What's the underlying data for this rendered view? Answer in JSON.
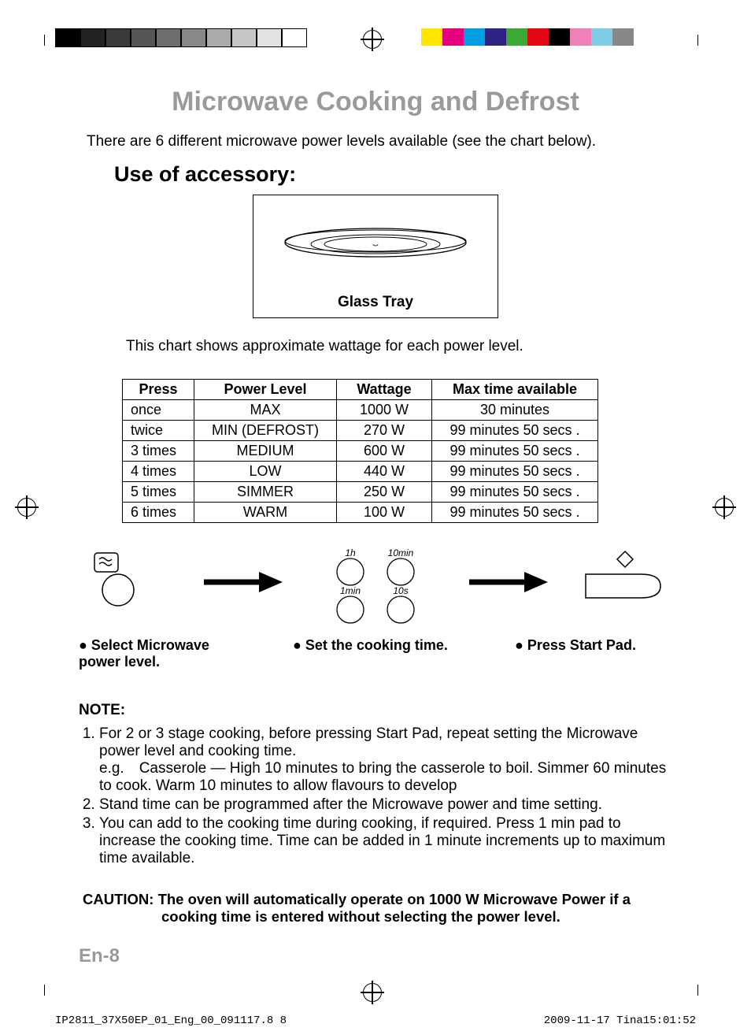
{
  "title": "Microwave Cooking and Defrost",
  "intro": "There are 6 different microwave power levels available (see the chart below).",
  "subheading": "Use of accessory:",
  "tray_label": "Glass Tray",
  "chart_intro": "This chart shows approximate wattage for each power level.",
  "table": {
    "headers": [
      "Press",
      "Power Level",
      "Wattage",
      "Max time available"
    ],
    "rows": [
      [
        "once",
        "MAX",
        "1000 W",
        "30 minutes"
      ],
      [
        "twice",
        "MIN (DEFROST)",
        "270 W",
        "99 minutes 50 secs ."
      ],
      [
        "3 times",
        "MEDIUM",
        "600 W",
        "99 minutes 50 secs ."
      ],
      [
        "4 times",
        "LOW",
        "440 W",
        "99 minutes 50 secs ."
      ],
      [
        "5 times",
        "SIMMER",
        "250 W",
        "99 minutes 50 secs ."
      ],
      [
        "6 times",
        "WARM",
        "100 W",
        "99 minutes 50 secs ."
      ]
    ]
  },
  "dial_labels": {
    "tl": "1h",
    "tr": "10min",
    "bl": "1min",
    "br": "10s"
  },
  "steps": {
    "s1": "● Select Microwave power level.",
    "s2": "● Set the cooking time.",
    "s3": "● Press Start Pad."
  },
  "note_heading": "NOTE:",
  "notes": [
    "For 2 or 3 stage cooking, before pressing Start Pad, repeat setting the Microwave power level and cooking time.\ne.g. Casserole — High 10 minutes to bring the casserole to boil. Simmer 60 minutes to cook. Warm 10 minutes to allow flavours to develop",
    "Stand time can be programmed after the Microwave power and time setting.",
    " You can add to the cooking time during cooking, if required. Press 1 min pad to increase the cooking time. Time can be added in 1 minute increments up to maximum time available."
  ],
  "caution_line1": "CAUTION: The oven will automatically operate on 1000 W Microwave Power if a",
  "caution_line2": "cooking time is entered without selecting the power level.",
  "page_num": "En-8",
  "footer_left": "IP2811_37X50EP_01_Eng_00_091117.8   8",
  "footer_right": "2009-11-17   Tina15:01:52",
  "chart_data": {
    "type": "table",
    "title": "Approximate wattage for each power level",
    "columns": [
      "Press",
      "Power Level",
      "Wattage",
      "Max time available"
    ],
    "rows": [
      {
        "press": "once",
        "level": "MAX",
        "wattage_w": 1000,
        "max_time": "30 minutes"
      },
      {
        "press": "twice",
        "level": "MIN (DEFROST)",
        "wattage_w": 270,
        "max_time": "99 minutes 50 secs"
      },
      {
        "press": "3 times",
        "level": "MEDIUM",
        "wattage_w": 600,
        "max_time": "99 minutes 50 secs"
      },
      {
        "press": "4 times",
        "level": "LOW",
        "wattage_w": 440,
        "max_time": "99 minutes 50 secs"
      },
      {
        "press": "5 times",
        "level": "SIMMER",
        "wattage_w": 250,
        "max_time": "99 minutes 50 secs"
      },
      {
        "press": "6 times",
        "level": "WARM",
        "wattage_w": 100,
        "max_time": "99 minutes 50 secs"
      }
    ]
  }
}
